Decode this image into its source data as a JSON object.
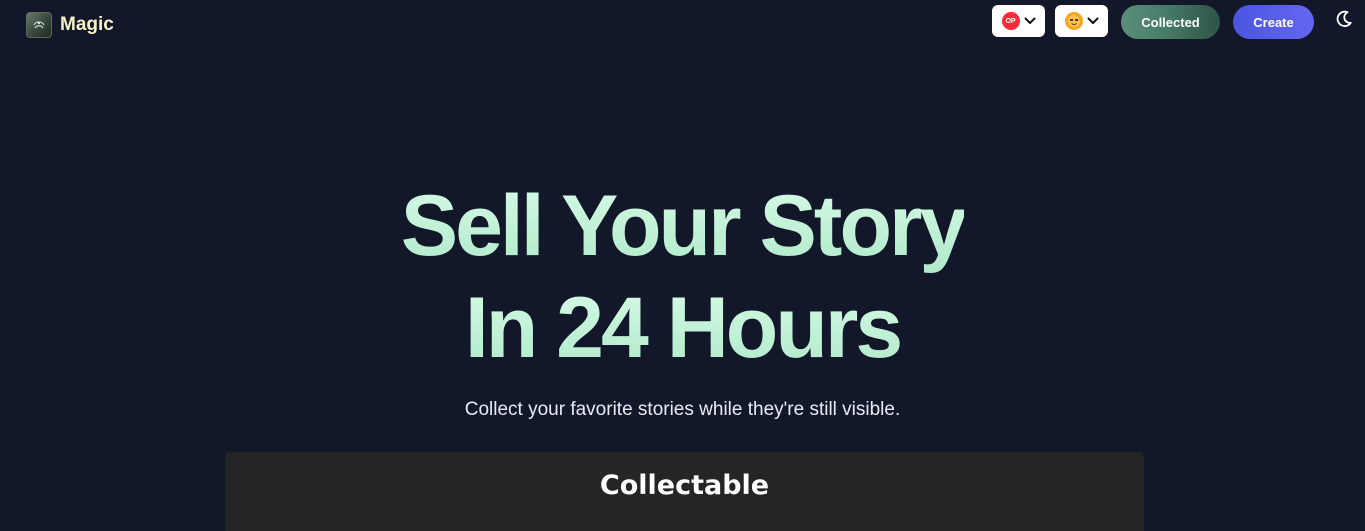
{
  "brand": {
    "name": "Magic",
    "logo_icon": "magic-logo-icon"
  },
  "header": {
    "network_selector": {
      "badge_text": "OP",
      "badge_color": "#ff2a37",
      "icon": "chevron-down-icon"
    },
    "user_selector": {
      "avatar_icon": "emoji-avatar-icon",
      "icon": "chevron-down-icon"
    },
    "collected_label": "Collected",
    "create_label": "Create",
    "theme_toggle_icon": "moon-icon"
  },
  "hero": {
    "line1": "Sell Your Story",
    "line2": "In 24 Hours",
    "subtitle": "Collect your favorite stories while they're still visible."
  },
  "section": {
    "title": "Collectable"
  },
  "colors": {
    "background": "#121729",
    "hero_text": "#c9f5dc",
    "collected_button": "#4a7e6a",
    "create_button": "#5a5ee8",
    "panel": "#252525"
  }
}
